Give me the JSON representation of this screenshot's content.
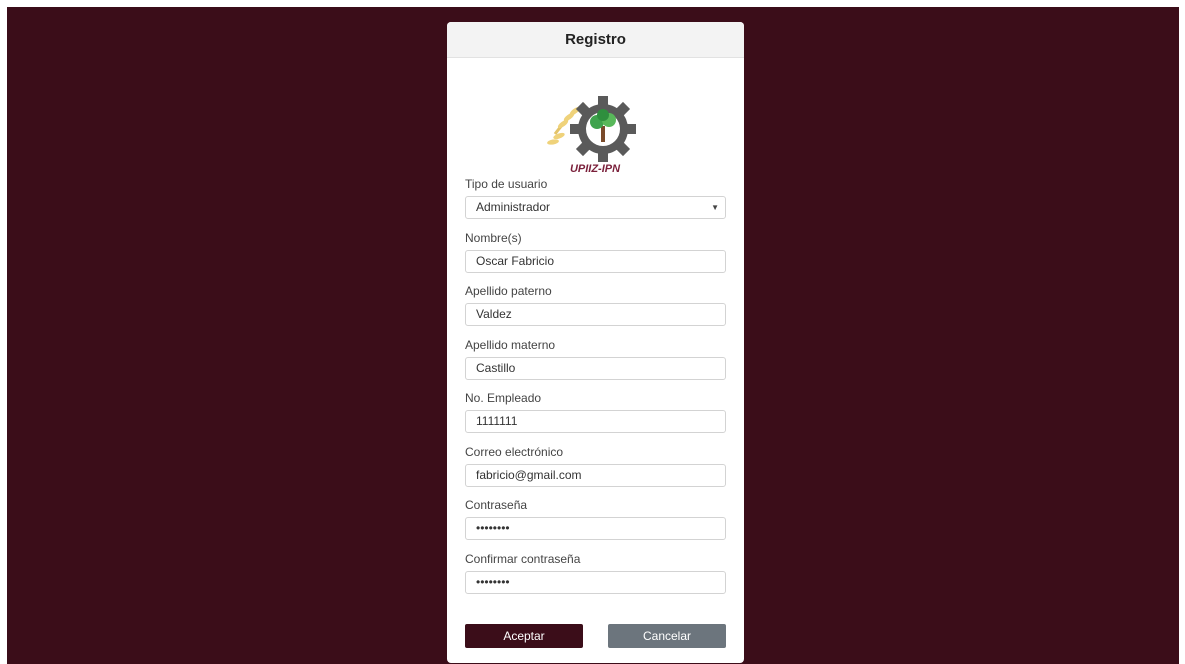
{
  "card": {
    "title": "Registro"
  },
  "logo": {
    "text": "UPIIZ-IPN"
  },
  "form": {
    "tipo_usuario": {
      "label": "Tipo de usuario",
      "value": "Administrador"
    },
    "nombre": {
      "label": "Nombre(s)",
      "value": "Oscar Fabricio"
    },
    "apellido_paterno": {
      "label": "Apellido paterno",
      "value": "Valdez"
    },
    "apellido_materno": {
      "label": "Apellido materno",
      "value": "Castillo"
    },
    "no_empleado": {
      "label": "No. Empleado",
      "value": "1111111"
    },
    "correo": {
      "label": "Correo electrónico",
      "value": "fabricio@gmail.com"
    },
    "contrasena": {
      "label": "Contraseña",
      "value": "••••••••"
    },
    "confirmar": {
      "label": "Confirmar contraseña",
      "value": "••••••••"
    }
  },
  "buttons": {
    "accept": "Aceptar",
    "cancel": "Cancelar"
  },
  "icons": {
    "select_arrow": "chevron-down-icon"
  },
  "colors": {
    "background": "#3b0d19",
    "accept_button": "#3b0d19",
    "cancel_button": "#6c757d",
    "logo_text": "#7a1f3a"
  }
}
